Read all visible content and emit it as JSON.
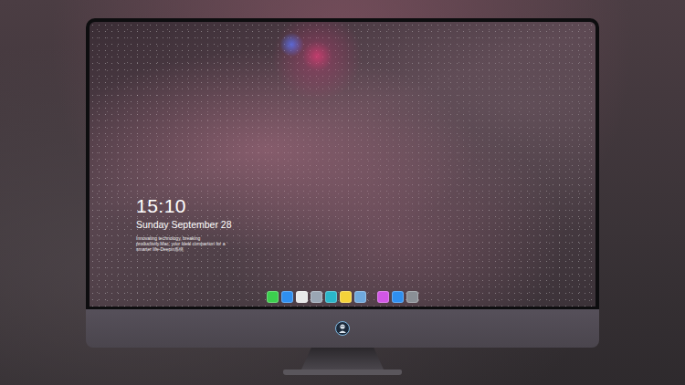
{
  "desktop": {
    "clock": {
      "time": "15:10",
      "date": "Sunday September 28",
      "tagline": "Innovating technology, breaking productivity.Mac, your ideal companion for a smarter life-Deepin系统"
    }
  },
  "dock": {
    "groups": [
      [
        {
          "color": "#3ccf4e"
        },
        {
          "color": "#2f8ff0"
        },
        {
          "color": "#e8e8e8"
        },
        {
          "color": "#9aa6b4"
        },
        {
          "color": "#2bb6c9"
        },
        {
          "color": "#f5d23a"
        },
        {
          "color": "#6fa8dc"
        }
      ],
      [
        {
          "color": "#d257e6"
        },
        {
          "color": "#2f8ff0"
        },
        {
          "color": "#8a8f96"
        }
      ]
    ]
  }
}
